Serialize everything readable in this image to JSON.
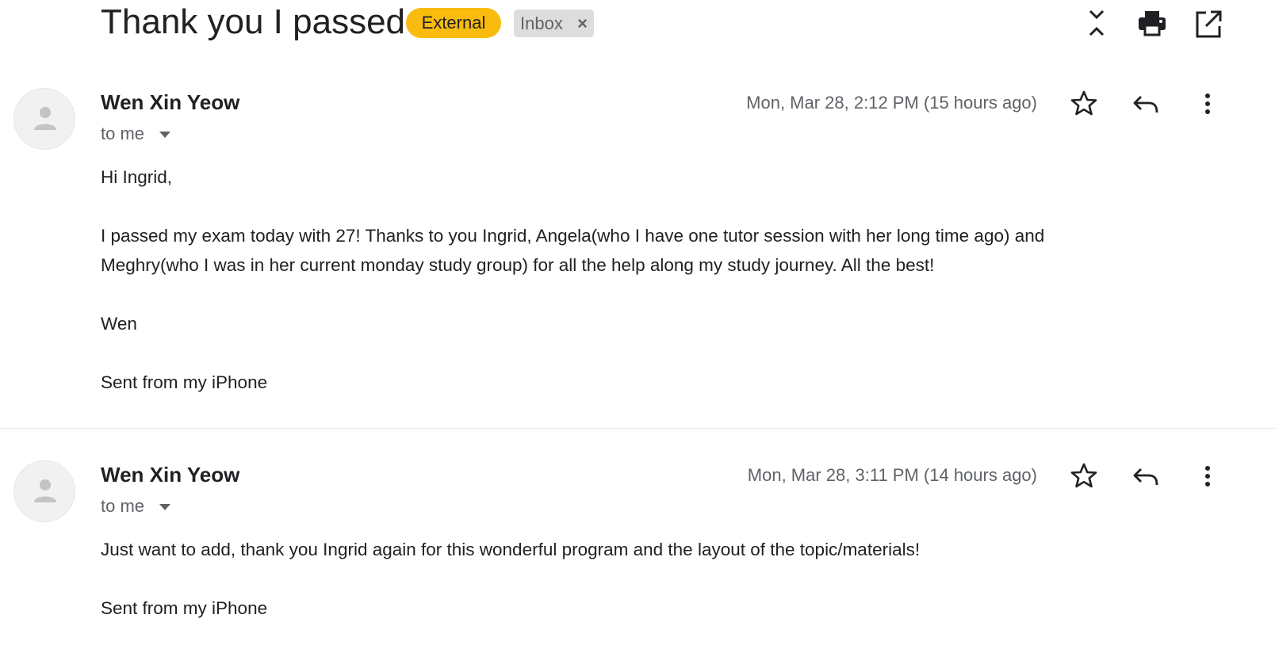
{
  "thread": {
    "subject": "Thank you I passed",
    "labels": {
      "external": "External",
      "inbox": "Inbox",
      "inbox_remove": "×"
    },
    "toolbar": {
      "collapse_icon": "collapse-all-icon",
      "print_icon": "print-icon",
      "open_new_window_icon": "open-in-new-window-icon"
    }
  },
  "colors": {
    "external_badge": "#f9bb0e",
    "inbox_badge": "#dddddd",
    "text_primary": "#202124",
    "text_secondary": "#5f6368"
  },
  "messages": [
    {
      "sender": "Wen Xin Yeow",
      "recipient": "to me",
      "timestamp": "Mon, Mar 28, 2:12 PM (15 hours ago)",
      "body": {
        "greeting": "Hi Ingrid,",
        "paragraph1_line1": "I passed my exam today with 27! Thanks to you Ingrid, Angela(who I have one tutor session with her long time ago) and",
        "paragraph1_line2": "Meghry(who I was in her current monday study group) for all the help along my study journey. All the best!",
        "signoff": "Wen",
        "signature": "Sent from my iPhone"
      }
    },
    {
      "sender": "Wen Xin Yeow",
      "recipient": "to me",
      "timestamp": "Mon, Mar 28, 3:11 PM (14 hours ago)",
      "body": {
        "line1": "Just want to add, thank you Ingrid again for this wonderful program and the layout of the topic/materials!",
        "signature": "Sent from my iPhone"
      }
    }
  ]
}
